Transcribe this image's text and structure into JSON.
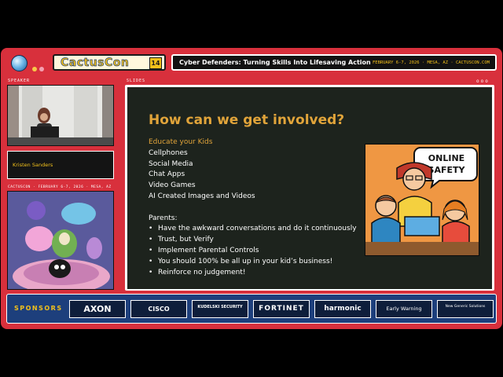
{
  "header": {
    "logo_text": "CactusCon",
    "logo_edition": "14",
    "talk_title": "Cyber Defenders: Turning Skills Into Lifesaving Action",
    "event_info": "FEBRUARY 6-7, 2026 · MESA, AZ · CACTUSCON.COM"
  },
  "left_panel": {
    "speaker_label": "SPEAKER",
    "speaker_name": "Kristen Sanders",
    "art_caption": "CACTUSCON · FEBRUARY 6-7, 2026 · MESA, AZ"
  },
  "slides_panel": {
    "label": "SLIDES"
  },
  "slide": {
    "heading": "How can we get involved?",
    "intro": "Educate your Kids",
    "kid_items": [
      "Cellphones",
      "Social Media",
      "Chat Apps",
      "Video Games",
      "AI Created Images and Videos"
    ],
    "parents_heading": "Parents:",
    "bullet_char": "•",
    "parent_items": [
      "Have the awkward conversations and do it continuously",
      "Trust, but Verify",
      "Implement Parental Controls",
      "You should 100% be all up in your kid’s business!",
      "Reinforce no judgement!"
    ],
    "illustration_text_line1": "ONLINE",
    "illustration_text_line2": "SAFETY"
  },
  "sponsors": {
    "label": "SPONSORS",
    "items": [
      "AXON",
      "CISCO",
      "KUDELSKI SECURITY",
      "FORTINET",
      "harmonic",
      "Early Warning",
      "New Generic Solutions"
    ]
  },
  "colors": {
    "frame_red": "#d8303c",
    "accent_yellow": "#f2c01b",
    "slide_orange": "#e1a43a",
    "sponsor_blue": "#1d3f7c"
  }
}
